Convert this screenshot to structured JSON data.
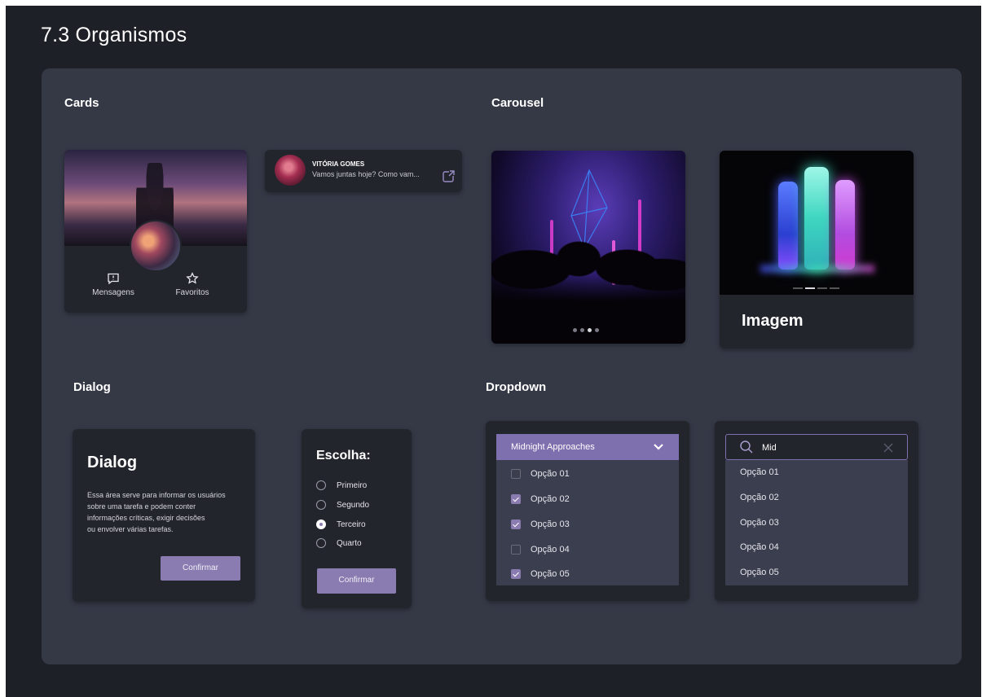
{
  "page": {
    "title": "7.3 Organismos"
  },
  "sections": {
    "cards": "Cards",
    "carousel": "Carousel",
    "dialog": "Dialog",
    "dropdown": "Dropdown"
  },
  "profile_card": {
    "actions": [
      {
        "label": "Mensagens",
        "icon": "message-alert-icon"
      },
      {
        "label": "Favoritos",
        "icon": "star-icon"
      }
    ]
  },
  "chat_card": {
    "name": "VITÓRIA GOMES",
    "message": "Vamos juntas hoje? Como vam...",
    "icon": "share-icon"
  },
  "carousel": {
    "first": {
      "dots": 4,
      "active_dot": 3
    },
    "second": {
      "label": "Imagem",
      "bars": 4,
      "active_bar": 2
    }
  },
  "dialog": {
    "title": "Dialog",
    "body_lines": [
      "Essa área serve para informar os usuários",
      "sobre uma tarefa e podem conter",
      "informações críticas, exigir decisões",
      "ou envolver várias tarefas."
    ],
    "confirm": "Confirmar"
  },
  "choice_dialog": {
    "title": "Escolha:",
    "options": [
      "Primeiro",
      "Segundo",
      "Terceiro",
      "Quarto"
    ],
    "selected": "Terceiro",
    "confirm": "Confirmar"
  },
  "dropdown": {
    "selected_label": "Midnight Approaches",
    "options": [
      {
        "label": "Opção 01",
        "checked": false
      },
      {
        "label": "Opção 02",
        "checked": true
      },
      {
        "label": "Opção 03",
        "checked": true
      },
      {
        "label": "Opção 04",
        "checked": false
      },
      {
        "label": "Opção 05",
        "checked": true
      }
    ]
  },
  "search_dropdown": {
    "query": "Mid",
    "options": [
      "Opção 01",
      "Opção 02",
      "Opção 03",
      "Opção 04",
      "Opção 05"
    ]
  },
  "colors": {
    "accent": "#7e6fae",
    "button": "#8a7cb0",
    "panel": "#353946",
    "background": "#1d2026"
  }
}
